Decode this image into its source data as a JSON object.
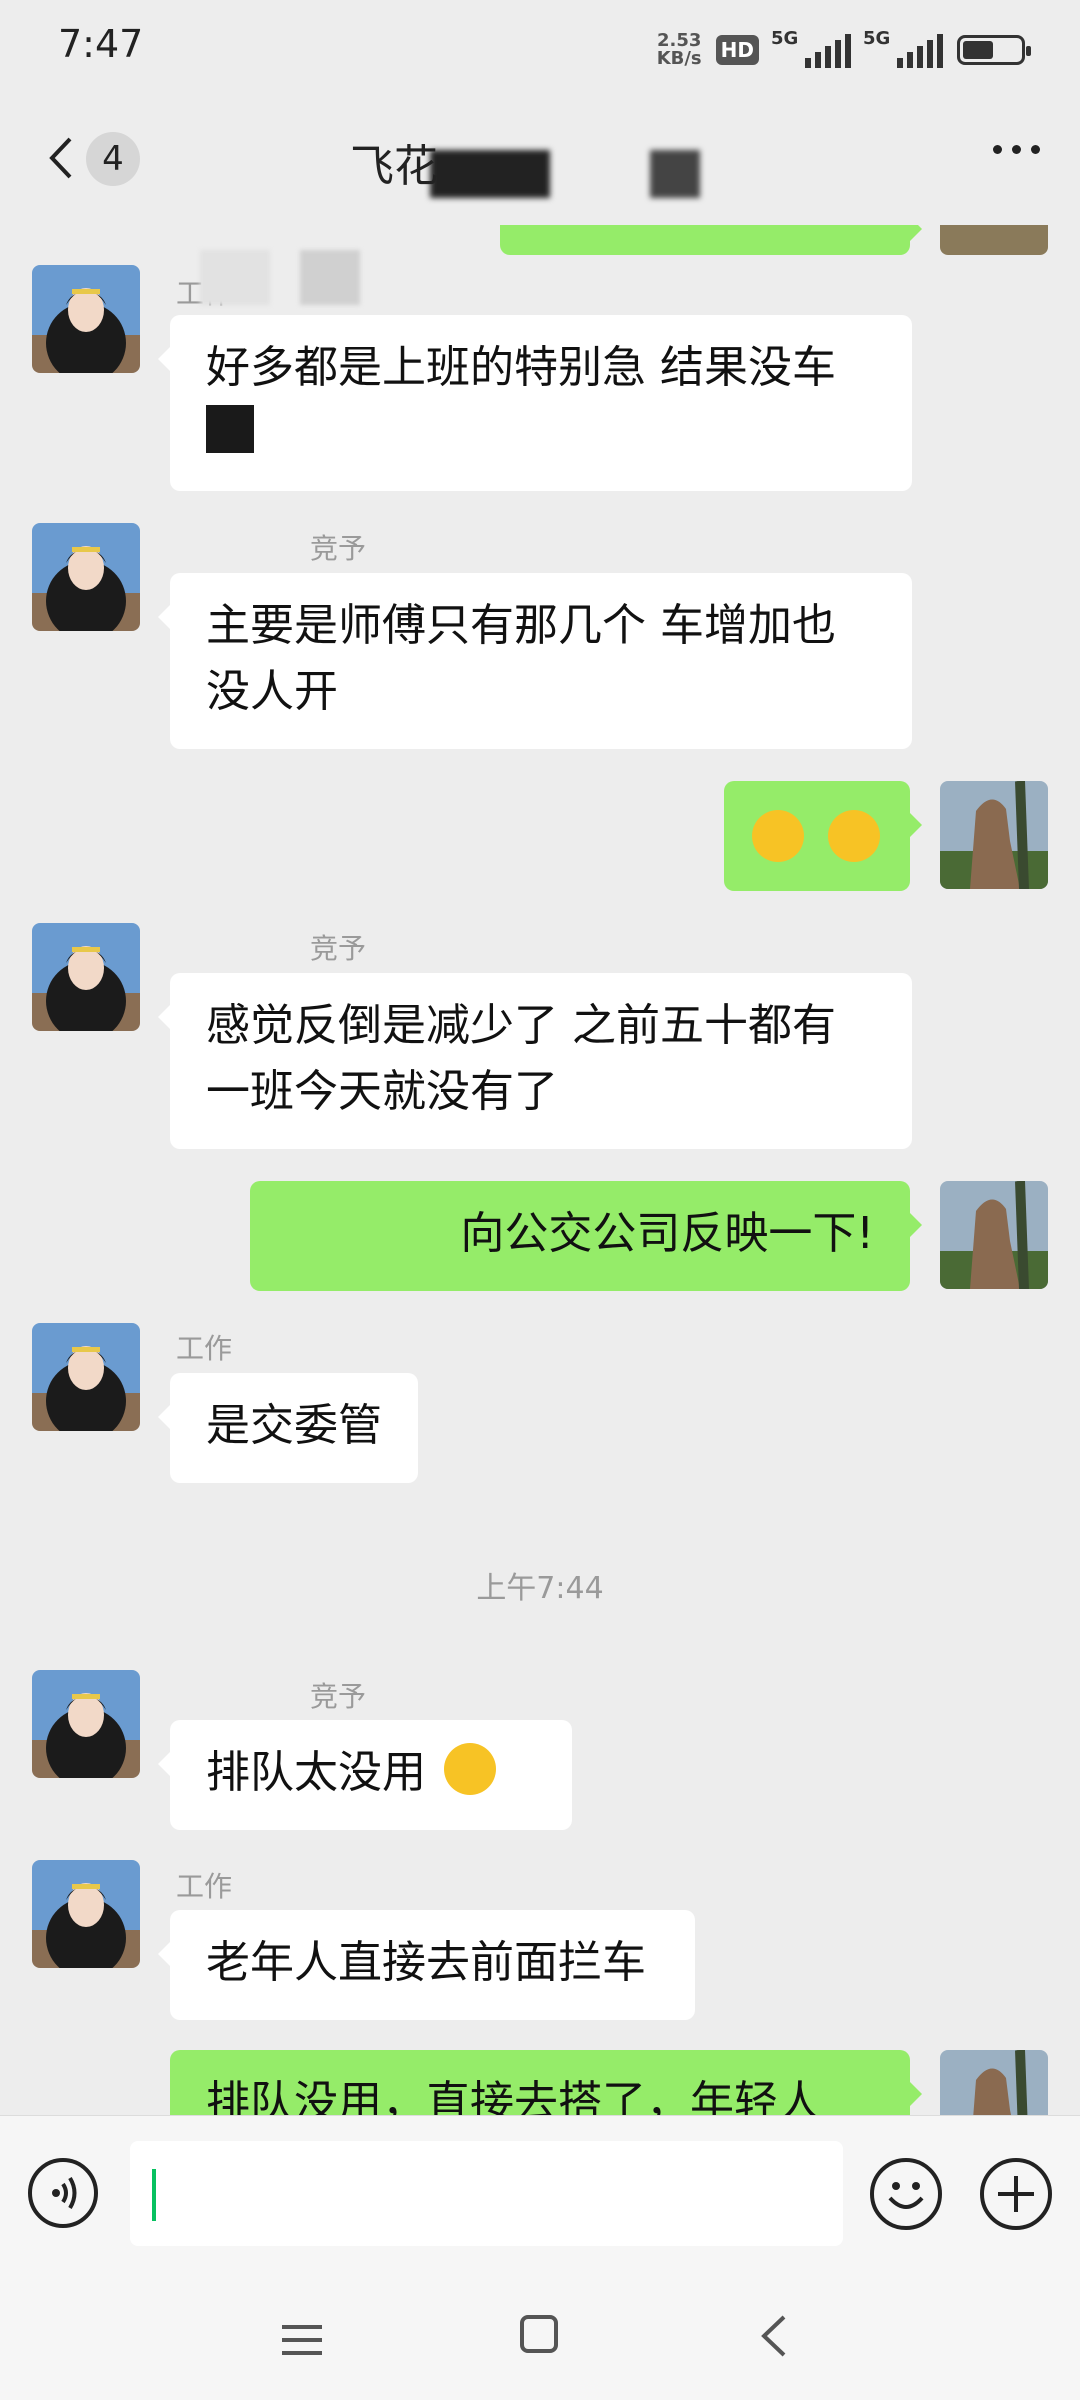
{
  "status_bar": {
    "time": "7:47",
    "net_speed_value": "2.53",
    "net_speed_unit": "KB/s",
    "hd_label": "HD",
    "signal1_label": "5G",
    "signal2_label": "5G",
    "battery_level": 0.5
  },
  "header": {
    "unread_count": "4",
    "chat_title": "飞花"
  },
  "messages": {
    "m1": {
      "sender": "工作",
      "text_line1": "好多都是上班的特别急 结果没车"
    },
    "m2": {
      "sender": "竞予",
      "text_line1": "主要是师傅只有那几个 车增加也",
      "text_line2": "没人开"
    },
    "m3": {
      "emojis": [
        "face-with-tears-of-joy",
        "grinning-face"
      ]
    },
    "m4": {
      "sender": "竞予",
      "text_line1": "感觉反倒是减少了 之前五十都有",
      "text_line2": "一班今天就没有了"
    },
    "m5": {
      "text": "向公交公司反映一下!"
    },
    "m6": {
      "sender": "工作",
      "text": "是交委管"
    },
    "timestamp": "上午7:44",
    "m7": {
      "sender": "竞予",
      "text": "排队太没用"
    },
    "m8": {
      "sender": "工作",
      "text": "老年人直接去前面拦车"
    },
    "m9": {
      "text": "排队没用，直接去搭了，年轻人"
    }
  },
  "colors": {
    "background": "#ededed",
    "outgoing_bubble": "#95ec69",
    "incoming_bubble": "#ffffff",
    "caret": "#07c160"
  }
}
